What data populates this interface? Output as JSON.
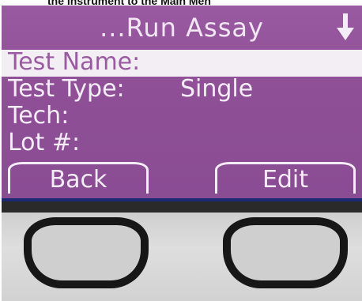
{
  "caption": "the instrument to the Main Men",
  "screen": {
    "title": "...Run Assay",
    "scroll_icon": "down-arrow-icon",
    "fields": [
      {
        "label": "Test Name:",
        "value": "",
        "selected": true
      },
      {
        "label": "Test Type:",
        "value": "Single",
        "selected": false
      },
      {
        "label": "Tech:",
        "value": "",
        "selected": false
      },
      {
        "label": "Lot #:",
        "value": "",
        "selected": false
      }
    ],
    "softkeys": {
      "left": "Back",
      "right": "Edit"
    },
    "colors": {
      "background": "#8e4f96",
      "text": "#f4ecf6",
      "highlight": "#f3eef4",
      "underline": "#1b2a73"
    }
  }
}
